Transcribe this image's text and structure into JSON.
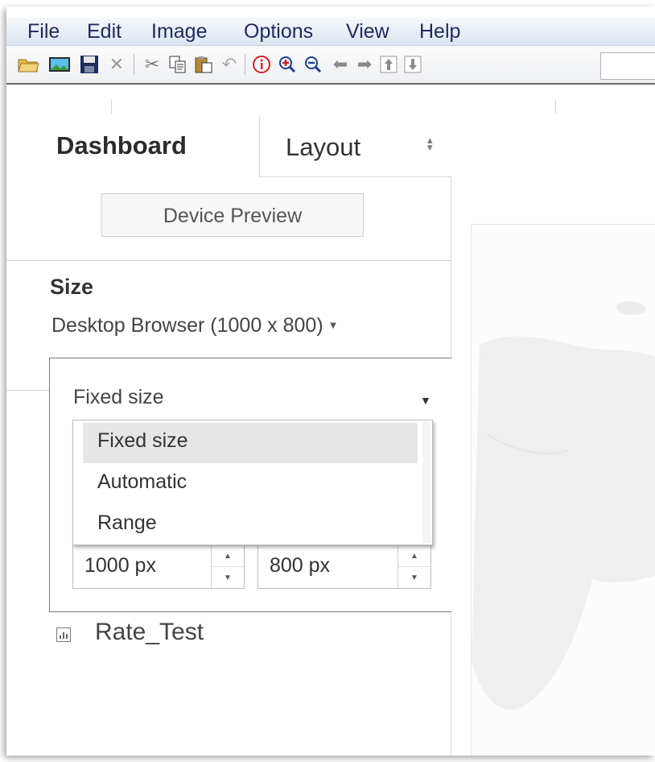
{
  "menu": {
    "items": [
      "File",
      "Edit",
      "Image",
      "Options",
      "View",
      "Help"
    ]
  },
  "toolbar": {
    "icons": [
      "open-folder-icon",
      "image-icon",
      "save-icon",
      "delete-icon",
      "cut-icon",
      "copy-icon",
      "paste-icon",
      "undo-icon",
      "info-icon",
      "zoom-in-icon",
      "zoom-out-icon",
      "arrow-left-icon",
      "arrow-right-icon",
      "arrow-up-icon",
      "arrow-down-icon"
    ],
    "colors": {
      "info": "#d42020",
      "zoom_in": "#c8202a",
      "zoom_out": "#1c3c8c"
    }
  },
  "panel": {
    "tabs": {
      "dashboard": "Dashboard",
      "layout": "Layout"
    },
    "device_preview_label": "Device Preview",
    "size_title": "Size",
    "size_preset": "Desktop Browser (1000 x 800)",
    "size_mode": {
      "selected": "Fixed size",
      "options": [
        "Fixed size",
        "Automatic",
        "Range"
      ],
      "highlighted_index": 0
    },
    "width_value": "1000 px",
    "height_value": "800 px",
    "sheet_name": "Rate_Test"
  }
}
